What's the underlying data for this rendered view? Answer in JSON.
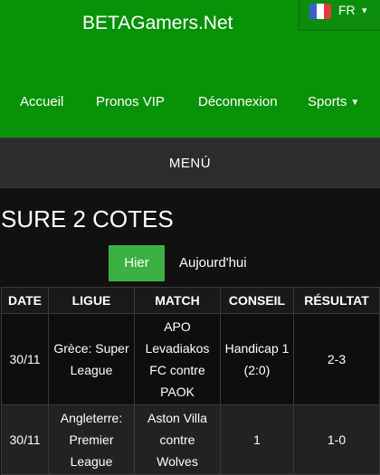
{
  "header": {
    "site_title": "BETAGamers.Net",
    "language": {
      "label": "FR",
      "flag_colors": [
        "#3a5fc8",
        "#ffffff",
        "#e03c3c"
      ]
    },
    "nav": [
      {
        "label": "Accueil"
      },
      {
        "label": "Pronos VIP"
      },
      {
        "label": "Déconnexion"
      },
      {
        "label": "Sports"
      }
    ]
  },
  "menu": {
    "label": "MENÚ"
  },
  "page": {
    "title": "SURE 2 COTES",
    "tabs": [
      {
        "label": "Hier",
        "active": true
      },
      {
        "label": "Aujourd'hui",
        "active": false
      }
    ]
  },
  "table": {
    "columns": [
      "DATE",
      "LIGUE",
      "MATCH",
      "CONSEIL",
      "RÉSULTAT"
    ],
    "rows": [
      {
        "date": "30/11",
        "league": "Grèce: Super League",
        "match": "APO Levadiakos FC contre PAOK",
        "tip": "Handicap 1 (2:0)",
        "result": "2-3"
      },
      {
        "date": "30/11",
        "league": "Angleterre: Premier League",
        "match": "Aston Villa contre Wolves",
        "tip": "1",
        "result": "1-0"
      }
    ]
  },
  "colors": {
    "header_green": "#089208",
    "active_tab": "#3cb043",
    "menu_bar": "#2c2c2c",
    "background": "#111111"
  }
}
